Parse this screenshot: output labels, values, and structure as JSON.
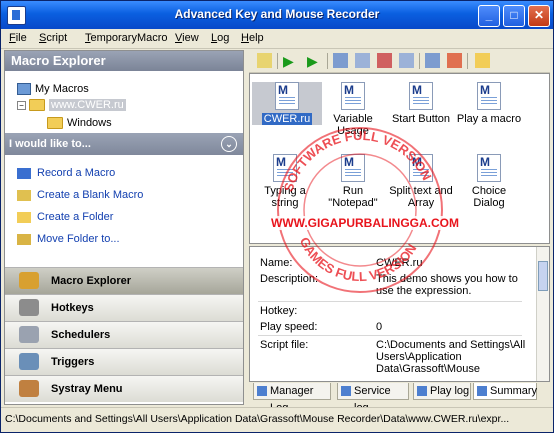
{
  "window": {
    "title": "Advanced Key and Mouse Recorder",
    "min": "_",
    "max": "□",
    "close": "✕"
  },
  "menu": [
    "File",
    "Script",
    "TemporaryMacro",
    "View",
    "Log",
    "Help"
  ],
  "left": {
    "header": "Macro Explorer",
    "tree": {
      "root": "My Macros",
      "site": "www.CWER.ru",
      "folder": "Windows"
    },
    "tasks_header": "I would like to...",
    "tasks": [
      "Record a Macro",
      "Create a Blank Macro",
      "Create a Folder",
      "Move Folder to..."
    ],
    "nav": [
      "Macro Explorer",
      "Hotkeys",
      "Schedulers",
      "Triggers",
      "Systray Menu"
    ]
  },
  "macros": [
    {
      "label": "CWER.ru",
      "selected": true
    },
    {
      "label": "Variable Usage"
    },
    {
      "label": "Start Button"
    },
    {
      "label": "Play a macro"
    },
    {
      "label": "Typing a string"
    },
    {
      "label": "Run \"Notepad\""
    },
    {
      "label": "Split text and Array"
    },
    {
      "label": "Choice Dialog"
    }
  ],
  "details": {
    "name_k": "Name:",
    "name_v": "CWER.ru",
    "desc_k": "Description:",
    "desc_v": "This demo shows you how to use the expression.",
    "hotkey_k": "Hotkey:",
    "hotkey_v": "",
    "speed_k": "Play speed:",
    "speed_v": "0",
    "file_k": "Script file:",
    "file_v": "C:\\Documents and Settings\\All Users\\Application Data\\Grassoft\\Mouse"
  },
  "tabs": [
    "Manager Log",
    "Service log",
    "Play log",
    "Summary"
  ],
  "status": "C:\\Documents and Settings\\All Users\\Application Data\\Grassoft\\Mouse Recorder\\Data\\www.CWER.ru\\expr...",
  "watermark": {
    "ring_top": "SOFTWARE FULL VERSION",
    "ring_bottom": "GAMES FULL VERSION",
    "url": "WWW.GIGAPURBALINGGA.COM"
  },
  "colors": {
    "title_blue": "#0a5fe0",
    "link_blue": "#1340b0",
    "watermark_red": "#e8141c"
  }
}
